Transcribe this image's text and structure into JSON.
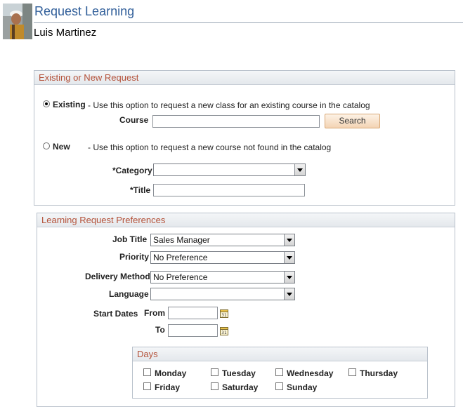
{
  "header": {
    "title": "Request Learning",
    "user_name": "Luis Martinez"
  },
  "request_section": {
    "title": "Existing or New Request",
    "existing": {
      "label": "Existing",
      "selected": true,
      "description": "- Use this option to request a new class for an existing course in the catalog"
    },
    "course_label": "Course",
    "course_value": "",
    "search_label": "Search",
    "new": {
      "label": "New",
      "selected": false,
      "description": "- Use this option to request a new course not found in the catalog"
    },
    "category_label": "*Category",
    "category_value": "",
    "title_label": "*Title",
    "title_value": ""
  },
  "preferences": {
    "title": "Learning Request Preferences",
    "job_title_label": "Job Title",
    "job_title_value": "Sales Manager",
    "priority_label": "Priority",
    "priority_value": "No Preference",
    "delivery_label": "Delivery Method",
    "delivery_value": "No Preference",
    "language_label": "Language",
    "language_value": "",
    "start_dates_label": "Start Dates",
    "from_label": "From",
    "to_label": "To",
    "days": {
      "title": "Days",
      "items": [
        "Monday",
        "Tuesday",
        "Wednesday",
        "Thursday",
        "Friday",
        "Saturday",
        "Sunday"
      ]
    }
  },
  "colors": {
    "title_blue": "#315f9a",
    "section_header_text": "#b4523a",
    "search_button": "#f3d4b4"
  },
  "icons": {
    "calendar": "calendar-icon",
    "dropdown": "chevron-down-icon"
  }
}
